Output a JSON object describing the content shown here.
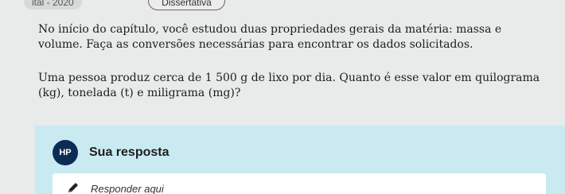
{
  "header": {
    "source_label": "ital - 2020",
    "question_type": "Dissertativa"
  },
  "question": {
    "intro": "No início do capítulo, você estudou duas propriedades gerais da matéria: massa e volume. Faça as conversões necessárias para encontrar os dados solicitados.",
    "prompt": "Uma pessoa produz cerca de 1 500 g de lixo por dia. Quanto é esse valor em quilograma (kg), tonelada (t) e miligrama (mg)?"
  },
  "answer": {
    "avatar_initials": "HP",
    "heading": "Sua resposta",
    "placeholder": "Responder aqui"
  },
  "icons": {
    "pencil": "pencil-icon"
  },
  "colors": {
    "answer_bg": "#c9eaf0",
    "avatar_bg": "#0b2c55"
  }
}
